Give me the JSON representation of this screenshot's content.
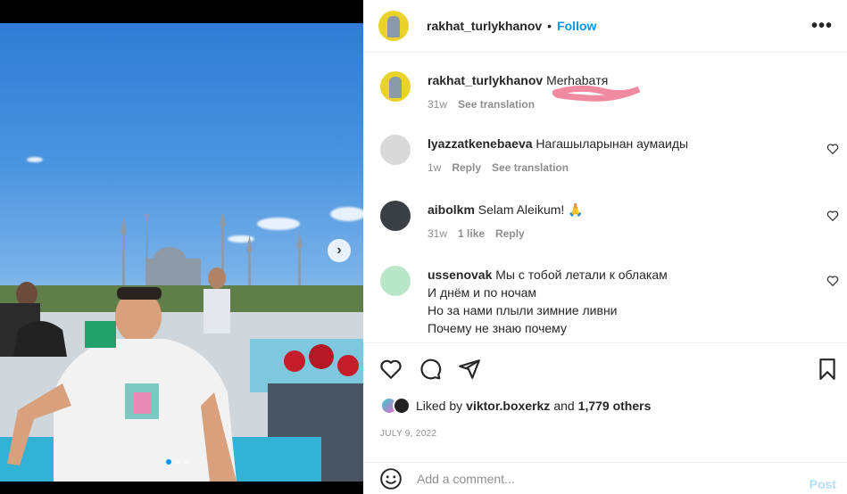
{
  "post": {
    "author": "rakhat_turlykhanov",
    "separator": "•",
    "follow_label": "Follow",
    "more_icon": "more-horizontal-icon",
    "carousel_next_icon": "chevron-right-icon",
    "slide_count": 3,
    "active_slide": 1
  },
  "caption": {
    "username": "rakhat_turlykhanov",
    "text": "Merhabaтя",
    "time": "31w",
    "see_translation": "See translation"
  },
  "comments": [
    {
      "username": "lyazzatkenebaeva",
      "lines": [
        "Нагашыларынан аумаиды"
      ],
      "time": "1w",
      "likes": "",
      "reply": "Reply",
      "see_translation": "See translation"
    },
    {
      "username": "aibolkm",
      "lines": [
        "Selam Aleikum! 🙏"
      ],
      "time": "31w",
      "likes": "1 like",
      "reply": "Reply",
      "see_translation": ""
    },
    {
      "username": "ussenovak",
      "lines": [
        "Мы с тобой летали к облакам",
        "И днём и по ночам",
        "Но за нами плыли зимние ливни",
        "Почему не знаю почему"
      ],
      "time": "",
      "likes": "",
      "reply": "",
      "see_translation": ""
    }
  ],
  "actions": {
    "like_icon": "heart-icon",
    "comment_icon": "comment-icon",
    "share_icon": "send-icon",
    "save_icon": "bookmark-icon"
  },
  "likes": {
    "prefix": "Liked by",
    "user": "viktor.boxerkz",
    "connector": "and",
    "others": "1,779 others"
  },
  "date": "JULY 9, 2022",
  "add_comment": {
    "placeholder": "Add a comment...",
    "post_label": "Post",
    "emoji_icon": "emoji-icon"
  },
  "colors": {
    "accent": "#0095f6",
    "post_disabled": "#b2dffc",
    "secondary_text": "#8e8e8e"
  }
}
